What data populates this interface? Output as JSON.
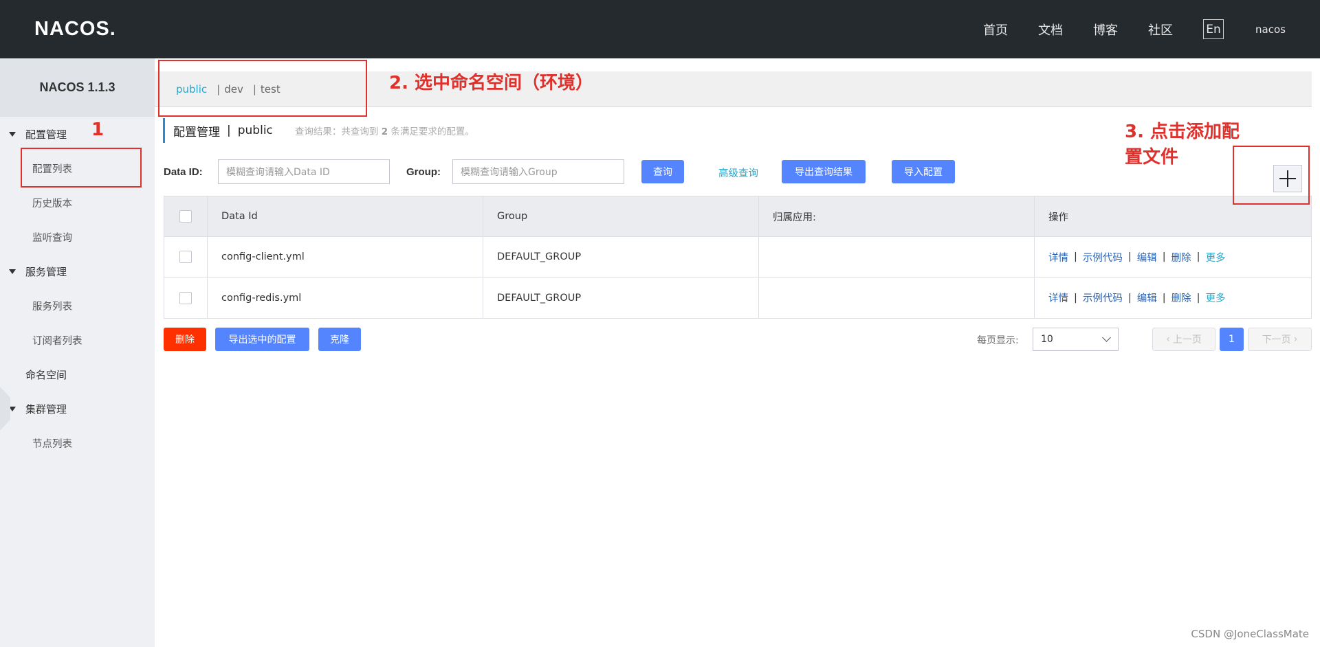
{
  "header": {
    "logo": "NACOS",
    "logo_dot": ".",
    "nav": [
      "首页",
      "文档",
      "博客",
      "社区"
    ],
    "lang": "En",
    "user": "nacos"
  },
  "sidebar": {
    "title": "NACOS 1.1.3",
    "groups": [
      {
        "label": "配置管理",
        "items": [
          "配置列表",
          "历史版本",
          "监听查询"
        ]
      },
      {
        "label": "服务管理",
        "items": [
          "服务列表",
          "订阅者列表"
        ]
      },
      {
        "label": "命名空间",
        "items": []
      },
      {
        "label": "集群管理",
        "items": [
          "节点列表"
        ]
      }
    ]
  },
  "namespaces": {
    "items": [
      "public",
      "dev",
      "test"
    ],
    "active": "public",
    "separator": "|"
  },
  "page": {
    "title": "配置管理",
    "separator": "|",
    "namespace": "public",
    "result_prefix": "查询结果：共查询到",
    "result_count": "2",
    "result_suffix": "条满足要求的配置。"
  },
  "search": {
    "data_id_label": "Data ID:",
    "data_id_placeholder": "模糊查询请输入Data ID",
    "group_label": "Group:",
    "group_placeholder": "模糊查询请输入Group",
    "query_button": "查询",
    "advanced_link": "高级查询",
    "export_button": "导出查询结果",
    "import_button": "导入配置"
  },
  "table": {
    "columns": [
      "Data Id",
      "Group",
      "归属应用:",
      "操作"
    ],
    "rows": [
      {
        "data_id": "config-client.yml",
        "group": "DEFAULT_GROUP",
        "app": ""
      },
      {
        "data_id": "config-redis.yml",
        "group": "DEFAULT_GROUP",
        "app": ""
      }
    ],
    "actions": {
      "detail": "详情",
      "sample": "示例代码",
      "edit": "编辑",
      "delete": "删除",
      "more": "更多",
      "sep": "|"
    }
  },
  "footer": {
    "delete_button": "删除",
    "export_selected_button": "导出选中的配置",
    "clone_button": "克隆",
    "page_size_label": "每页显示:",
    "page_size": "10",
    "prev": "上一页",
    "current_page": "1",
    "next": "下一页"
  },
  "annotations": {
    "a1": "1",
    "a2": "2. 选中命名空间（环境）",
    "a3_line1": "3. 点击添加配",
    "a3_line2": "置文件"
  },
  "watermark": "CSDN @JoneClassMate",
  "colors": {
    "header_bg": "#252a2f",
    "primary": "#5584ff",
    "danger": "#ff3000",
    "link": "#26a6c9",
    "annotation": "#e0302c"
  }
}
